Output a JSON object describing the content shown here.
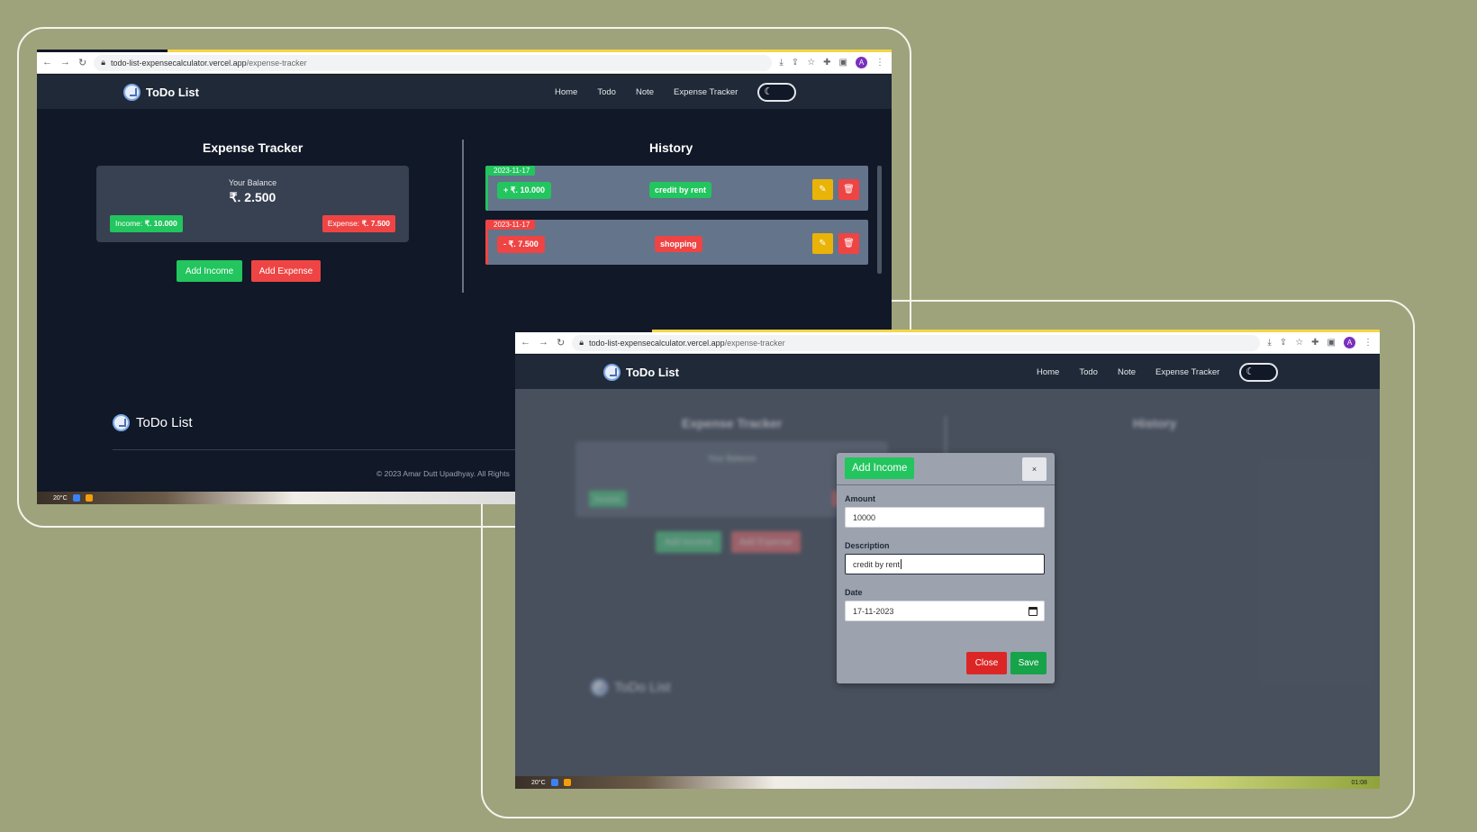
{
  "url": {
    "host": "todo-list-expensecalculator.vercel.app",
    "path": "/expense-tracker"
  },
  "profile_initial": "A",
  "brand": "ToDo List",
  "nav": [
    "Home",
    "Todo",
    "Note",
    "Expense Tracker"
  ],
  "tracker": {
    "title": "Expense Tracker",
    "balance_label": "Your Balance",
    "balance": "₹. 2.500",
    "income_label": "Income: ",
    "income_value": "₹. 10.000",
    "expense_label": "Expense: ",
    "expense_value": "₹. 7.500",
    "add_income": "Add Income",
    "add_expense": "Add Expense"
  },
  "history": {
    "title": "History",
    "items": [
      {
        "date": "2023-11-17",
        "amount": "+ ₹. 10.000",
        "desc": "credit by rent",
        "type": "income"
      },
      {
        "date": "2023-11-17",
        "amount": "- ₹. 7.500",
        "desc": "shopping",
        "type": "expense"
      }
    ]
  },
  "footer": {
    "brand": "ToDo List",
    "copyright": "© 2023 Amar Dutt Upadhyay. All Rights"
  },
  "taskbar": {
    "temp": "20°C",
    "time": "01:08"
  },
  "modal": {
    "title": "Add Income",
    "close_x": "×",
    "amount_label": "Amount",
    "amount_value": "10000",
    "description_label": "Description",
    "description_value": "credit by rent",
    "date_label": "Date",
    "date_value": "17-11-2023",
    "close_button": "Close",
    "save_button": "Save"
  },
  "colors": {
    "income": "#22c55e",
    "expense": "#ef4444",
    "edit": "#eab308",
    "page_bg": "#111827",
    "nav_bg": "#1f2937"
  }
}
